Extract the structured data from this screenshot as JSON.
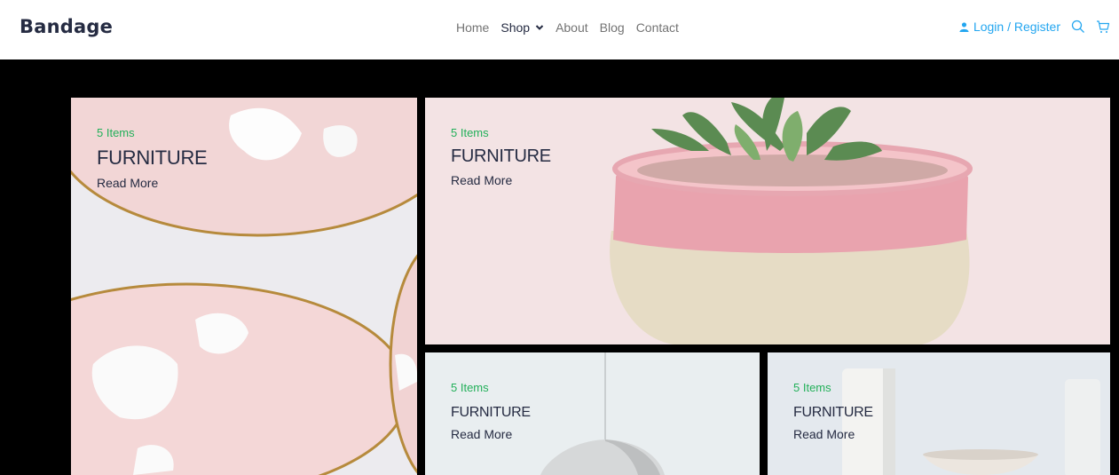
{
  "header": {
    "brand": "Bandage",
    "nav": [
      {
        "label": "Home"
      },
      {
        "label": "Shop"
      },
      {
        "label": "About"
      },
      {
        "label": "Blog"
      },
      {
        "label": "Contact"
      }
    ],
    "login_label": "Login / Register",
    "icons": [
      "user-icon",
      "search-icon",
      "cart-icon",
      "chevron-down-icon"
    ]
  },
  "cards": [
    {
      "items": "5 Items",
      "title": "FURNITURE",
      "cta": "Read More"
    },
    {
      "items": "5 Items",
      "title": "FURNITURE",
      "cta": "Read More"
    },
    {
      "items": "5 Items",
      "title": "FURNITURE",
      "cta": "Read More"
    },
    {
      "items": "5 Items",
      "title": "FURNITURE",
      "cta": "Read More"
    }
  ],
  "colors": {
    "brand_text": "#252b42",
    "nav_text": "#737373",
    "accent_blue": "#23a6f0",
    "items_green": "#23b05a",
    "hero_bg": "#000000"
  }
}
